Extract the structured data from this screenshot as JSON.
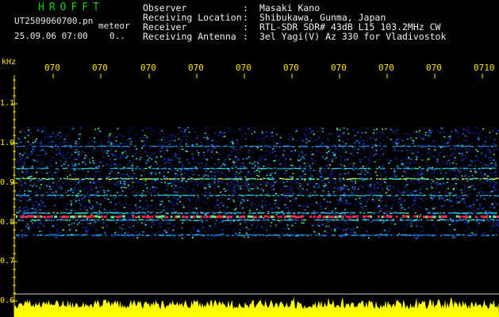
{
  "header": {
    "software": "HROFFT",
    "filename": "UT2509060700.pn",
    "tag": "meteor",
    "timestamp": "25.09.06 07:00",
    "count": "0..",
    "info": [
      {
        "label": "Observer",
        "colon": ":",
        "value": "Masaki Kano"
      },
      {
        "label": "Receiving Location",
        "colon": ":",
        "value": "Shibukawa, Gunma, Japan"
      },
      {
        "label": "Receiver",
        "colon": ":",
        "value": "RTL-SDR SDR# 43dB L15 103.2MHz CW"
      },
      {
        "label": "Receiving Antenna",
        "colon": ":",
        "value": "3el Yagi(V) Az 330 for Vladivostok"
      }
    ]
  },
  "axis": {
    "unit": "kHz",
    "y_ticks": [
      "1.1",
      "1.0",
      "0.9",
      "0.8",
      "0.7",
      "0.6"
    ],
    "x_ticks": [
      "070",
      "070",
      "070",
      "070",
      "070",
      "070",
      "070",
      "070",
      "070",
      "0710"
    ]
  },
  "colors": {
    "background": "#000000",
    "axis_text": "#ffe400",
    "header_text": "#f0f0f0",
    "logo": "#00d200",
    "echo_band": "#ff2040",
    "amplitude_trace": "#ffff00"
  }
}
